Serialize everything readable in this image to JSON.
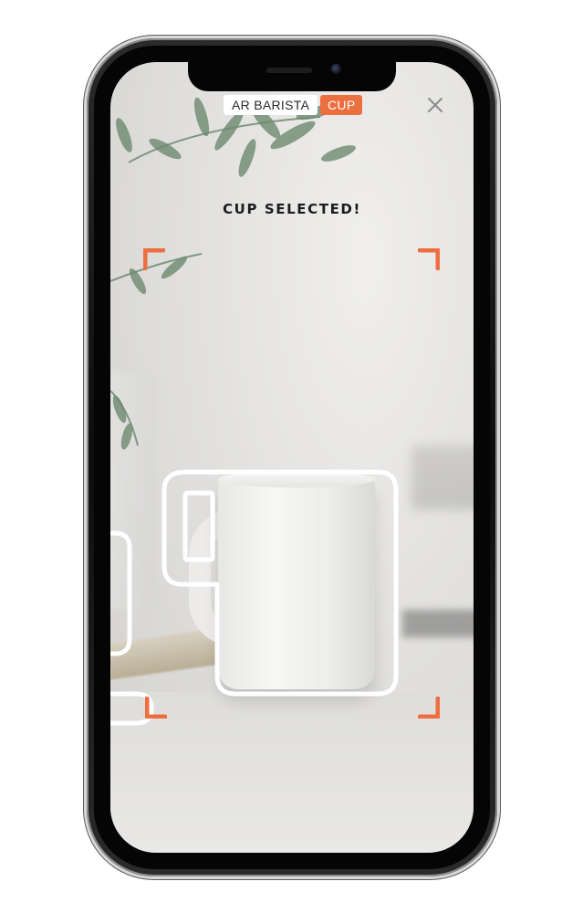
{
  "app": {
    "title": "AR BARISTA",
    "mode": "CUP"
  },
  "status": {
    "message": "CUP SELECTED!"
  },
  "icons": {
    "close": "close-icon",
    "corners": "scan-frame-corner-icon"
  },
  "colors": {
    "accent": "#ec6f40",
    "outline": "#ffffff",
    "text": "#1c1c1c"
  }
}
